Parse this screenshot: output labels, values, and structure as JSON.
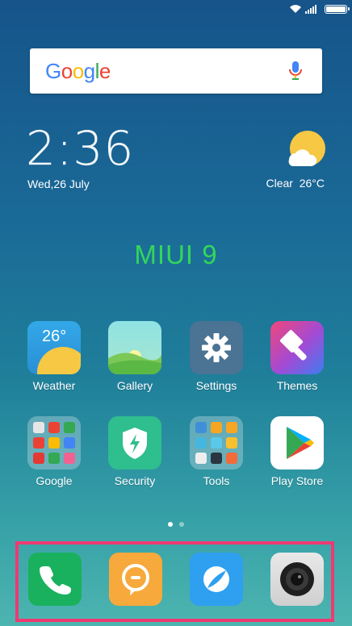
{
  "status_bar": {
    "wifi_icon": "wifi-icon",
    "signal_icon": "signal-icon",
    "battery_icon": "battery-icon",
    "battery_level": 1.0
  },
  "search": {
    "logo_letters": [
      "G",
      "o",
      "o",
      "g",
      "l",
      "e"
    ],
    "mic_icon": "mic-icon"
  },
  "clock": {
    "time": "2:36",
    "date": "Wed,26 July"
  },
  "weather_widget": {
    "condition": "Clear",
    "temperature": "26°C",
    "icon": "sun-cloud-icon"
  },
  "brand": "MIUI 9",
  "apps": [
    {
      "label": "Weather",
      "icon": "weather-icon",
      "tile_text": "26°"
    },
    {
      "label": "Gallery",
      "icon": "gallery-icon"
    },
    {
      "label": "Settings",
      "icon": "gear-icon"
    },
    {
      "label": "Themes",
      "icon": "paintbrush-icon"
    },
    {
      "label": "Google",
      "icon": "folder-icon"
    },
    {
      "label": "Security",
      "icon": "shield-icon"
    },
    {
      "label": "Tools",
      "icon": "folder-icon"
    },
    {
      "label": "Play Store",
      "icon": "play-store-icon"
    }
  ],
  "page_indicator": {
    "pages": 2,
    "current": 1
  },
  "dock": [
    {
      "name": "Phone",
      "icon": "phone-icon"
    },
    {
      "name": "Messaging",
      "icon": "message-icon"
    },
    {
      "name": "Browser",
      "icon": "browser-icon"
    },
    {
      "name": "Camera",
      "icon": "camera-icon"
    }
  ],
  "colors": {
    "brand": "#33d65a",
    "dock_highlight": "#ee3a72"
  }
}
